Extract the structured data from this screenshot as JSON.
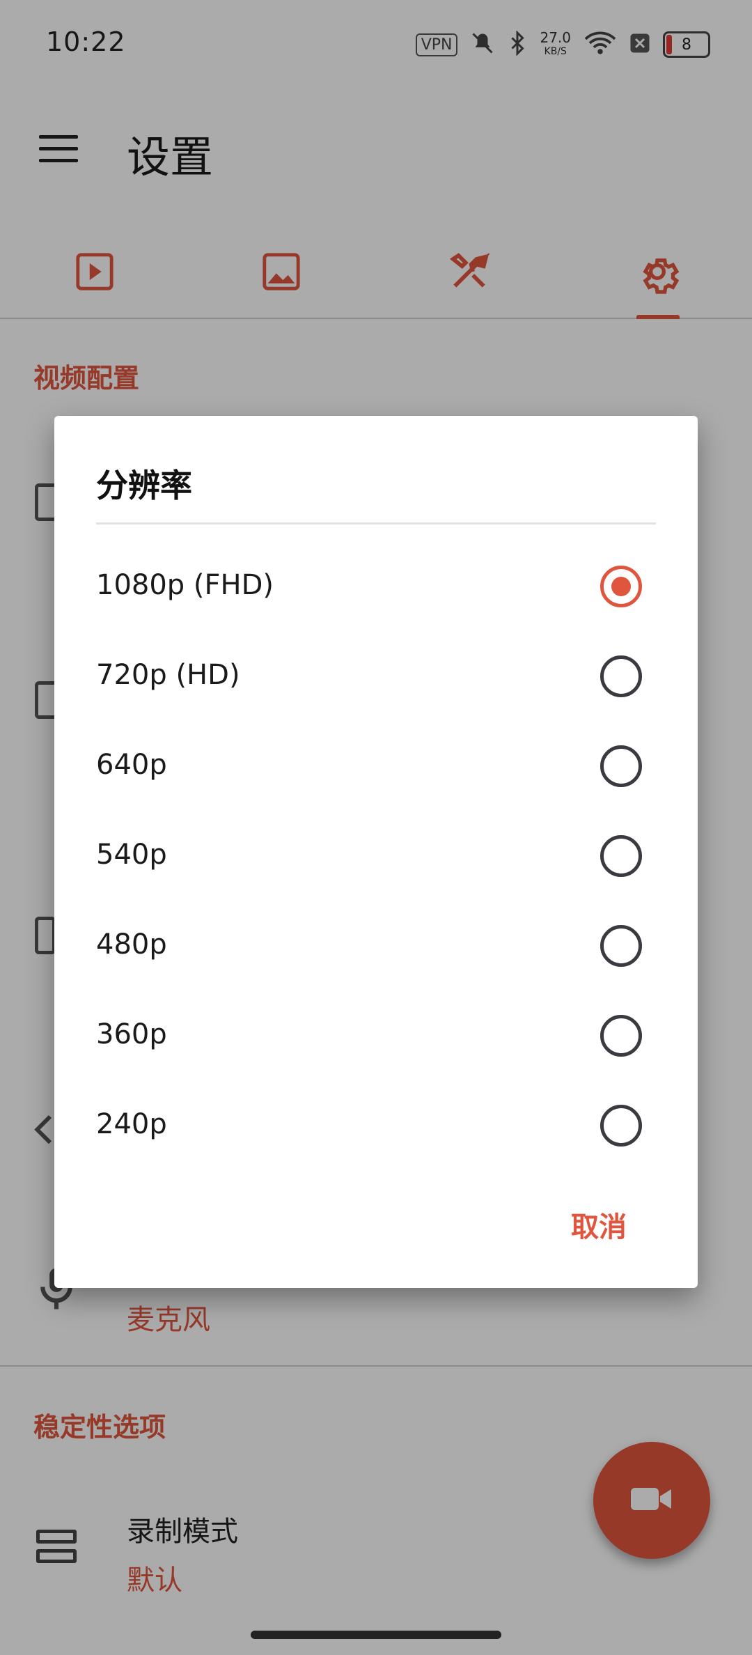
{
  "status_bar": {
    "time": "10:22",
    "vpn": "VPN",
    "net_speed": "27.0",
    "net_speed_unit": "KB/S",
    "battery": "8"
  },
  "app_bar": {
    "title": "设置"
  },
  "tabs": [
    {
      "icon": "video-icon"
    },
    {
      "icon": "image-icon"
    },
    {
      "icon": "tools-icon"
    },
    {
      "icon": "settings-gear-icon",
      "selected": true
    }
  ],
  "background": {
    "section_video": "视频配置",
    "mic_value": "麦克风",
    "section_stability": "稳定性选项",
    "record_mode_label": "录制模式",
    "record_mode_value": "默认"
  },
  "dialog": {
    "title": "分辨率",
    "options": [
      {
        "label": "1080p (FHD)",
        "selected": true
      },
      {
        "label": "720p (HD)",
        "selected": false
      },
      {
        "label": "640p",
        "selected": false
      },
      {
        "label": "540p",
        "selected": false
      },
      {
        "label": "480p",
        "selected": false
      },
      {
        "label": "360p",
        "selected": false
      },
      {
        "label": "240p",
        "selected": false
      }
    ],
    "cancel": "取消"
  },
  "colors": {
    "accent": "#e0553e",
    "scrim": "rgba(0,0,0,0.33)"
  }
}
